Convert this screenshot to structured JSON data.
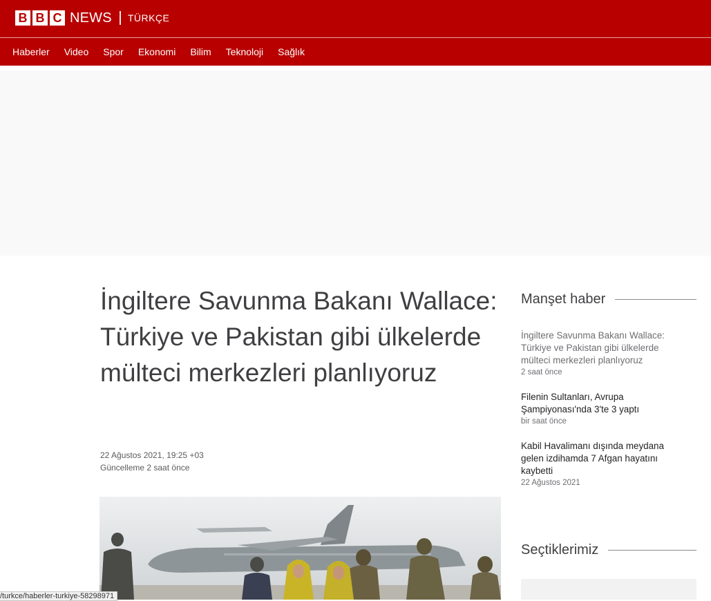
{
  "masthead": {
    "brand_letters": [
      "B",
      "B",
      "C"
    ],
    "brand_news": "NEWS",
    "service": "TÜRKÇE",
    "brand_color": "#b80000"
  },
  "nav": {
    "items": [
      {
        "label": "Haberler"
      },
      {
        "label": "Video"
      },
      {
        "label": "Spor"
      },
      {
        "label": "Ekonomi"
      },
      {
        "label": "Bilim"
      },
      {
        "label": "Teknoloji"
      },
      {
        "label": "Sağlık"
      }
    ]
  },
  "article": {
    "headline": "İngiltere Savunma Bakanı Wallace: Türkiye ve Pakistan gibi ülkelerde mülteci merkezleri planlıyoruz",
    "published": "22 Ağustos 2021, 19:25 +03",
    "updated": "Güncelleme 2 saat önce"
  },
  "sidebar": {
    "top_heading": "Manşet haber",
    "top_stories": [
      {
        "title": "İngiltere Savunma Bakanı Wallace: Türkiye ve Pakistan gibi ülkelerde mülteci merkezleri planlıyoruz",
        "time": "2 saat önce",
        "visited": true
      },
      {
        "title": "Filenin Sultanları, Avrupa Şampiyonası'nda 3'te 3 yaptı",
        "time": "bir saat önce",
        "visited": false
      },
      {
        "title": "Kabil Havalimanı dışında meydana gelen izdihamda 7 Afgan hayatını kaybetti",
        "time": "22 Ağustos 2021",
        "visited": false
      }
    ],
    "picks_heading": "Seçtiklerimiz"
  },
  "status_bar": {
    "url": "/turkce/haberler-turkiye-58298971"
  }
}
